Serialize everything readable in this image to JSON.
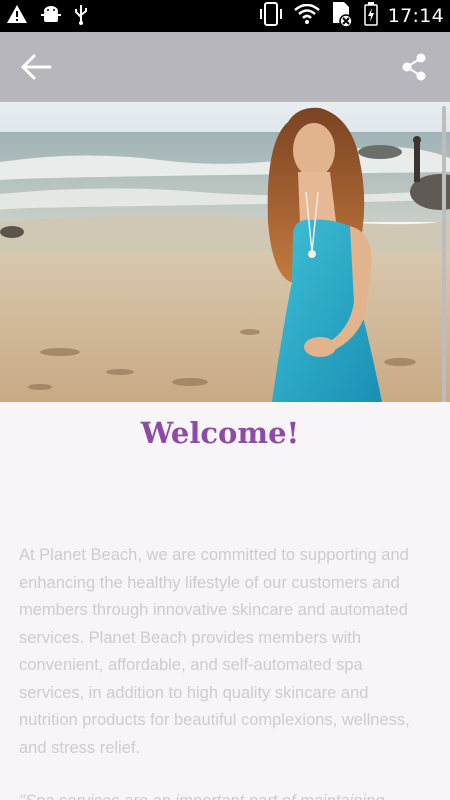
{
  "status_bar": {
    "time": "17:14",
    "icons": [
      "warning-icon",
      "android-debug-icon",
      "usb-icon",
      "vibrate-icon",
      "wifi-icon",
      "no-sim-icon",
      "battery-charging-icon"
    ]
  },
  "app_bar": {
    "back_icon": "arrow-left-icon",
    "share_icon": "share-icon",
    "background": "#b8b6bd"
  },
  "content": {
    "welcome_title": "Welcome!",
    "intro_paragraph": "At Planet Beach, we are committed to supporting and enhancing the healthy lifestyle of our customers and members through innovative skincare and automated services. Planet Beach provides members with convenient, affordable, and self-automated spa services, in addition to high quality skincare and nutrition products for beautiful complexions, wellness, and stress relief.",
    "quote_start": "\"Spa services are an important part of maintaining"
  },
  "colors": {
    "accent": "#8e4aa6",
    "body_text": "#cfcbd0"
  }
}
